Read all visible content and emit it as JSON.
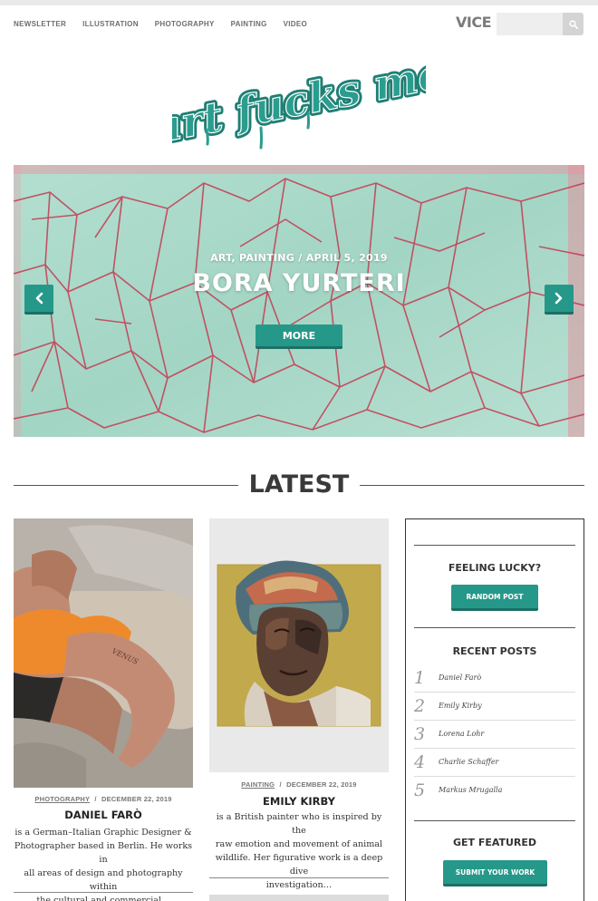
{
  "nav": {
    "items": [
      "NEWSLETTER",
      "ILLUSTRATION",
      "PHOTOGRAPHY",
      "PAINTING",
      "VIDEO"
    ]
  },
  "header": {
    "vice_label": "VICE",
    "search_value": "",
    "logo_text": "art fucks me",
    "brand_color": "#26988a"
  },
  "hero": {
    "categories": "ART, PAINTING",
    "separator": "/",
    "date": "APRIL 5, 2019",
    "title": "BORA YURTERI",
    "more_label": "MORE"
  },
  "section": {
    "latest_label": "LATEST"
  },
  "posts": [
    {
      "category": "PHOTOGRAPHY",
      "date": "DECEMBER 22, 2019",
      "title": "DANIEL FARÒ",
      "line1": "is a German–Italian Graphic Designer &",
      "line2": "Photographer based in Berlin. He works in",
      "line3": "all areas of design and photography within",
      "line4": "the cultural and commercial…"
    },
    {
      "category": "PAINTING",
      "date": "DECEMBER 22, 2019",
      "title": "EMILY KIRBY",
      "line1": "is a British painter who is inspired by the",
      "line2": "raw emotion and movement of animal",
      "line3": "wildlife. Her figurative work is a deep dive",
      "line4": "investigation…"
    }
  ],
  "sidebar": {
    "lucky_heading": "FEELING LUCKY?",
    "random_label": "RANDOM POST",
    "recent_heading": "RECENT POSTS",
    "recent": [
      {
        "num": "1",
        "name": "Daniel Farò"
      },
      {
        "num": "2",
        "name": "Emily Kirby"
      },
      {
        "num": "3",
        "name": "Lorena Lohr"
      },
      {
        "num": "4",
        "name": "Charlie Schaffer"
      },
      {
        "num": "5",
        "name": "Markus Mrugalla"
      }
    ],
    "featured_heading": "GET FEATURED",
    "submit_label": "SUBMIT YOUR WORK"
  }
}
